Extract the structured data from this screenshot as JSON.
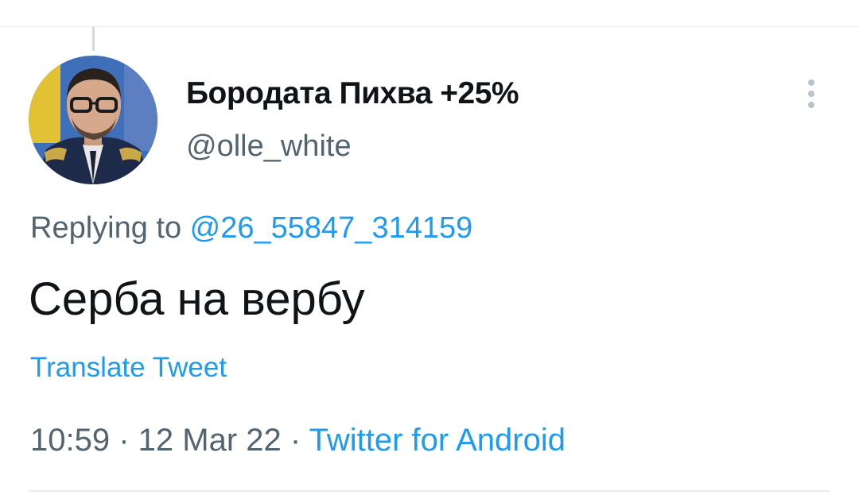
{
  "tweet": {
    "author": {
      "display_name": "Бородата Пихва +25%",
      "handle": "@olle_white",
      "avatar": "avatar-photo"
    },
    "more_icon": "vertical-ellipsis-icon",
    "reply": {
      "prefix": "Replying to ",
      "mention": "@26_55847_314159"
    },
    "text": "Серба на вербу",
    "translate_label": "Translate Tweet",
    "meta": {
      "time": "10:59",
      "separator": " · ",
      "date": "12 Mar 22",
      "source": "Twitter for Android"
    }
  },
  "colors": {
    "link": "#1d9bf0",
    "secondary_text": "#536471",
    "primary_text": "#0f1419",
    "divider": "#e6ecf0"
  }
}
